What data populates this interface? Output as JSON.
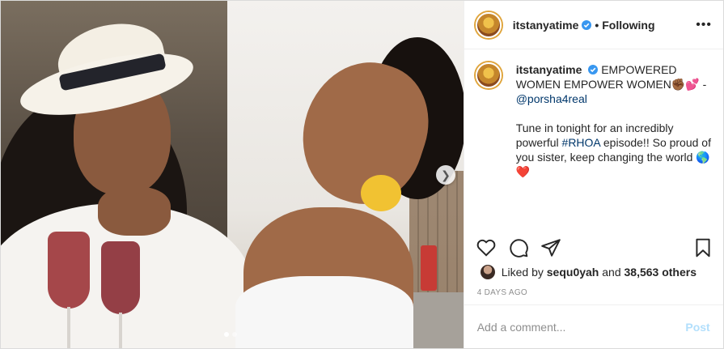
{
  "post": {
    "username": "itstanyatime",
    "following_label": "• Following",
    "more_icon": "more-horizontal-icon",
    "caption": {
      "username": "itstanyatime",
      "line1": "EMPOWERED WOMEN EMPOWER WOMEN",
      "emoji1": "✊🏾💕",
      "dash": " -",
      "mention": "@porsha4real",
      "para2_start": "Tune in tonight for an incredibly powerful ",
      "hashtag": "#RHOA",
      "para2_end": " episode!! So proud of you sister, keep changing the world ",
      "emoji2": "🌎",
      "heart": "❤️"
    },
    "actions": [
      "heart-icon",
      "comment-icon",
      "share-icon",
      "bookmark-icon"
    ],
    "likes": {
      "prefix": "Liked by ",
      "user": "sequ0yah",
      "middle": " and ",
      "count": "38,563 others"
    },
    "date": "4 DAYS AGO",
    "comment_placeholder": "Add a comment...",
    "post_label": "Post",
    "carousel": {
      "slides": 2,
      "active": 1
    },
    "colors": {
      "verified": "#3897f0",
      "link": "#00376b",
      "post_disabled": "#b2dffc",
      "muted": "#8e8e8e"
    }
  }
}
